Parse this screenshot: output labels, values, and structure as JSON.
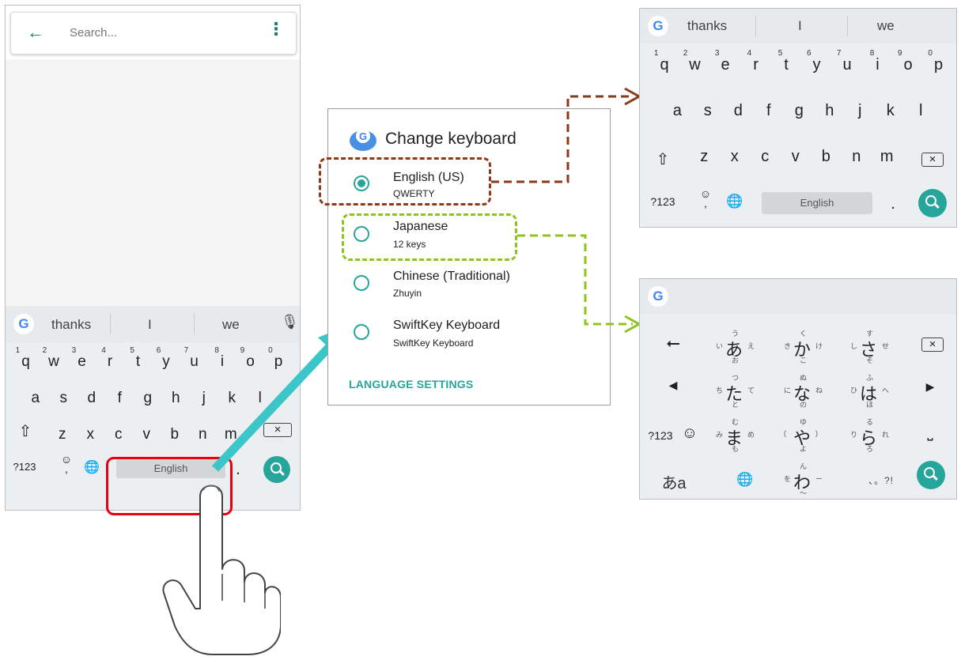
{
  "colors": {
    "accent": "#26a69a",
    "brown_callout": "#8b3a1a",
    "green_callout": "#8fc31f",
    "red_highlight": "#e60012",
    "cyan_arrow": "#3cc6c9"
  },
  "search": {
    "placeholder": "Search...",
    "back_icon": "arrow-left-icon",
    "menu_icon": "more-vert-icon"
  },
  "phone_keyboard": {
    "suggestions": [
      "thanks",
      "I",
      "we"
    ],
    "rows": [
      [
        "q",
        "w",
        "e",
        "r",
        "t",
        "y",
        "u",
        "i",
        "o",
        "p"
      ],
      [
        "a",
        "s",
        "d",
        "f",
        "g",
        "h",
        "j",
        "k",
        "l"
      ],
      [
        "z",
        "x",
        "c",
        "v",
        "b",
        "n",
        "m"
      ]
    ],
    "digits": [
      "1",
      "2",
      "3",
      "4",
      "5",
      "6",
      "7",
      "8",
      "9",
      "0"
    ],
    "symbols_key": "?123",
    "space_label": "English",
    "period": "."
  },
  "dialog": {
    "title": "Change keyboard",
    "options": [
      {
        "name": "English (US)",
        "sub": "QWERTY",
        "selected": true
      },
      {
        "name": "Japanese",
        "sub": "12 keys",
        "selected": false
      },
      {
        "name": "Chinese (Traditional)",
        "sub": "Zhuyin",
        "selected": false
      },
      {
        "name": "SwiftKey Keyboard",
        "sub": "SwiftKey Keyboard",
        "selected": false
      }
    ],
    "language_settings": "LANGUAGE SETTINGS"
  },
  "english_keyboard": {
    "suggestions": [
      "thanks",
      "I",
      "we"
    ],
    "symbols_key": "?123",
    "space_label": "English",
    "period": "."
  },
  "japanese_keyboard": {
    "keys": [
      {
        "main": "あ",
        "top": "う",
        "left": "い",
        "right": "え",
        "bottom": "お"
      },
      {
        "main": "か",
        "top": "く",
        "left": "き",
        "right": "け",
        "bottom": "こ"
      },
      {
        "main": "さ",
        "top": "す",
        "left": "し",
        "right": "せ",
        "bottom": "そ"
      },
      {
        "main": "た",
        "top": "つ",
        "left": "ち",
        "right": "て",
        "bottom": "と"
      },
      {
        "main": "な",
        "top": "ぬ",
        "left": "に",
        "right": "ね",
        "bottom": "の"
      },
      {
        "main": "は",
        "top": "ふ",
        "left": "ひ",
        "right": "へ",
        "bottom": "ほ"
      },
      {
        "main": "ま",
        "top": "む",
        "left": "み",
        "right": "め",
        "bottom": "も"
      },
      {
        "main": "や",
        "top": "ゆ",
        "left": "(",
        "right": ")",
        "bottom": "よ"
      },
      {
        "main": "ら",
        "top": "る",
        "left": "り",
        "right": "れ",
        "bottom": "ろ"
      },
      {
        "main": "わ",
        "top": "ん",
        "left": "を",
        "right": "ー",
        "bottom": "〜"
      }
    ],
    "punct_key": "、。?!",
    "symbols_key": "?123",
    "kana_key": "あa"
  }
}
